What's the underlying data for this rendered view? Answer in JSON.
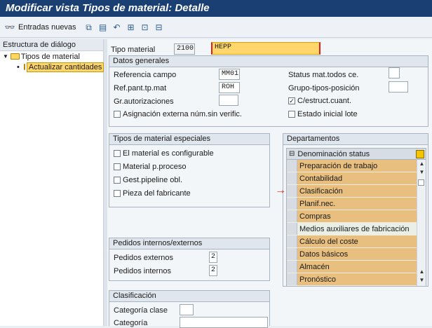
{
  "window": {
    "title": "Modificar vista Tipos de material: Detalle"
  },
  "toolbar": {
    "new_entries_label": "Entradas nuevas",
    "icons": [
      "glasses-icon",
      "copy-icon",
      "delete-icon",
      "undo-icon",
      "select-block-icon",
      "select-all-icon",
      "deselect-icon"
    ]
  },
  "sidebar": {
    "header": "Estructura de diálogo",
    "root": "Tipos de material",
    "child": "Actualizar cantidades"
  },
  "header_fields": {
    "tipo_material_label": "Tipo material",
    "tipo_material_code": "2100",
    "tipo_material_value": "HEPP"
  },
  "datos_generales": {
    "title": "Datos generales",
    "referencia_campo_label": "Referencia campo",
    "referencia_campo_value": "MM01",
    "ref_pant_label": "Ref.pant.tp.mat",
    "ref_pant_value": "ROH",
    "gr_autorizaciones_label": "Gr.autorizaciones",
    "gr_autorizaciones_value": "",
    "asignacion_label": "Asignación externa núm.sin verific.",
    "asignacion_checked": false,
    "status_label": "Status mat.todos ce.",
    "status_value": "",
    "grupo_tipos_label": "Grupo-tipos-posición",
    "grupo_tipos_value": "",
    "c_estruct_label": "C/estruct.cuant.",
    "c_estruct_checked": true,
    "estado_inicial_label": "Estado inicial lote",
    "estado_inicial_checked": false
  },
  "tipos_especiales": {
    "title": "Tipos de material especiales",
    "items": [
      {
        "label": "El material es configurable",
        "checked": false
      },
      {
        "label": "Material p.proceso",
        "checked": false
      },
      {
        "label": "Gest.pipeline obl.",
        "checked": false
      },
      {
        "label": "Pieza del fabricante",
        "checked": false
      }
    ]
  },
  "departamentos": {
    "title": "Departamentos",
    "column_header": "Denominación status",
    "items": [
      {
        "label": "Preparación de trabajo",
        "active": true
      },
      {
        "label": "Contabilidad",
        "active": true
      },
      {
        "label": "Clasificación",
        "active": true
      },
      {
        "label": "Planif.nec.",
        "active": true
      },
      {
        "label": "Compras",
        "active": true
      },
      {
        "label": "Medios auxiliares de fabricación",
        "active": false
      },
      {
        "label": "Cálculo del coste",
        "active": true
      },
      {
        "label": "Datos básicos",
        "active": true
      },
      {
        "label": "Almacén",
        "active": true
      },
      {
        "label": "Pronóstico",
        "active": true
      }
    ],
    "active_color": "#e8bf7e",
    "inactive_color": "#eaf0e6"
  },
  "pedidos": {
    "title": "Pedidos internos/externos",
    "externos_label": "Pedidos externos",
    "externos_value": "2",
    "internos_label": "Pedidos internos",
    "internos_value": "2"
  },
  "clasificacion": {
    "title": "Clasificación",
    "categoria_clase_label": "Categoría clase",
    "categoria_clase_value": "",
    "categoria_label": "Categoría",
    "categoria_value": ""
  },
  "colors": {
    "title_bar": "#1a3f73",
    "highlight_input": "#ffd66b",
    "annotation_arrow": "#e02020"
  }
}
